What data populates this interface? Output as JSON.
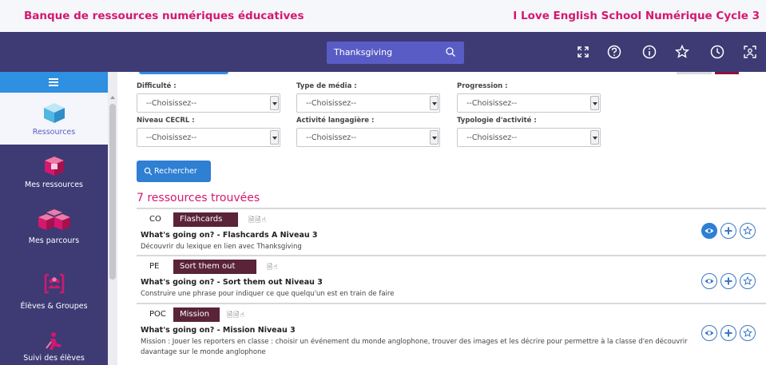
{
  "banner": {
    "left_title": "Banque de ressources numériques éducatives",
    "right_title": "I Love English School Numérique Cycle 3"
  },
  "header": {
    "search_value": "Thanksgiving",
    "icons": [
      "fullscreen-icon",
      "help-icon",
      "info-icon",
      "star-icon",
      "history-icon",
      "scan-icon"
    ]
  },
  "sidebar": {
    "items": [
      {
        "label": "Ressources",
        "icon": "cube-icon",
        "active": true
      },
      {
        "label": "Mes ressources",
        "icon": "my-cube-icon",
        "active": false
      },
      {
        "label": "Mes parcours",
        "icon": "cubes-icon",
        "active": false
      },
      {
        "label": "Élèves & Groupes",
        "icon": "group-icon",
        "active": false
      },
      {
        "label": "Suivi des élèves",
        "icon": "tracking-icon",
        "active": false
      }
    ]
  },
  "filters": {
    "difficulte": {
      "label": "Difficulté :",
      "value": "--Choisissez--"
    },
    "type_media": {
      "label": "Type de média :",
      "value": "--Choisissez--"
    },
    "progression": {
      "label": "Progression :",
      "value": "--Choisissez--"
    },
    "niveau_cecrl": {
      "label": "Niveau CECRL :",
      "value": "--Choisissez--"
    },
    "activite": {
      "label": "Activité langagière :",
      "value": "--Choisissez--"
    },
    "typologie": {
      "label": "Typologie d'activité :",
      "value": "--Choisissez--"
    }
  },
  "search_button": "Rechercher",
  "results_count": "7 ressources trouvées",
  "results": [
    {
      "code": "CO",
      "tag": "Flashcards",
      "docs": "🗎🗎☝",
      "title": "What's going on? - Flashcards A Niveau 3",
      "description": "Découvrir du lexique en lien avec Thanksgiving"
    },
    {
      "code": "PE",
      "tag": "Sort them out",
      "docs": "🗎☝",
      "title": "What's going on? - Sort them out Niveau 3",
      "description": "Construire une phrase pour indiquer ce que quelqu'un est en train de faire"
    },
    {
      "code": "POC",
      "tag": "Mission",
      "docs": "🗎🗎☝",
      "title": "What's going on? - Mission Niveau 3",
      "description": "Mission : Jouer les reporters en classe : choisir un événement du monde anglophone, trouver des images et les décrire pour permettre à la classe d'en découvrir davantage sur le monde anglophone"
    }
  ],
  "colors": {
    "accent_pink": "#d4186f",
    "nav_purple": "#3e3a74",
    "button_blue": "#2f7fd3",
    "tag_maroon": "#5a2338"
  }
}
